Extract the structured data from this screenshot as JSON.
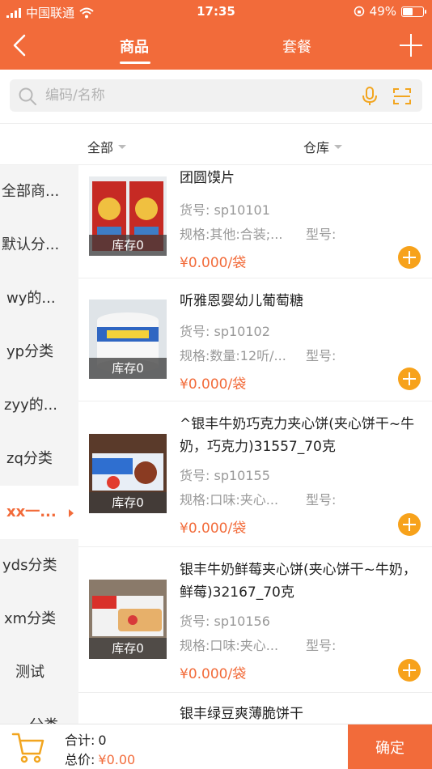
{
  "status_bar": {
    "carrier": "中国联通",
    "time": "17:35",
    "battery": "49%"
  },
  "nav": {
    "tabs": [
      {
        "label": "商品",
        "active": true
      },
      {
        "label": "套餐",
        "active": false
      }
    ],
    "accent": "#f26b3a"
  },
  "search": {
    "placeholder": "编码/名称",
    "value": ""
  },
  "filters": {
    "category": "全部",
    "warehouse": "仓库"
  },
  "sidebar": {
    "items": [
      {
        "label": "全部商..."
      },
      {
        "label": "默认分..."
      },
      {
        "label": "wy的..."
      },
      {
        "label": "yp分类"
      },
      {
        "label": "zyy的..."
      },
      {
        "label": "zq分类"
      },
      {
        "label": "xx一...",
        "active": true
      },
      {
        "label": "yds分类"
      },
      {
        "label": "xm分类"
      },
      {
        "label": "测试"
      },
      {
        "label": "...分类"
      }
    ]
  },
  "products": [
    {
      "name": "团圆馍片",
      "code": "货号: sp10101",
      "spec": "规格:其他:合装;...",
      "model": "型号:",
      "price": "¥0.000/袋",
      "stock": "库存0"
    },
    {
      "name": "听雅恩婴幼儿葡萄糖",
      "code": "货号: sp10102",
      "spec": "规格:数量:12听/...",
      "model": "型号:",
      "price": "¥0.000/袋",
      "stock": "库存0"
    },
    {
      "name": "^银丰牛奶巧克力夹心饼(夹心饼干~牛奶，巧克力)31557_70克",
      "code": "货号: sp10155",
      "spec": "规格:口味:夹心...",
      "model": "型号:",
      "price": "¥0.000/袋",
      "stock": "库存0"
    },
    {
      "name": "银丰牛奶鲜莓夹心饼(夹心饼干~牛奶，鲜莓)32167_70克",
      "code": "货号: sp10156",
      "spec": "规格:口味:夹心...",
      "model": "型号:",
      "price": "¥0.000/袋",
      "stock": "库存0"
    },
    {
      "name": "银丰绿豆爽薄脆饼干"
    }
  ],
  "footer": {
    "count_label": "合计:",
    "count_value": "0",
    "total_label": "总价:",
    "total_value": "¥0.00",
    "confirm_label": "确定"
  }
}
